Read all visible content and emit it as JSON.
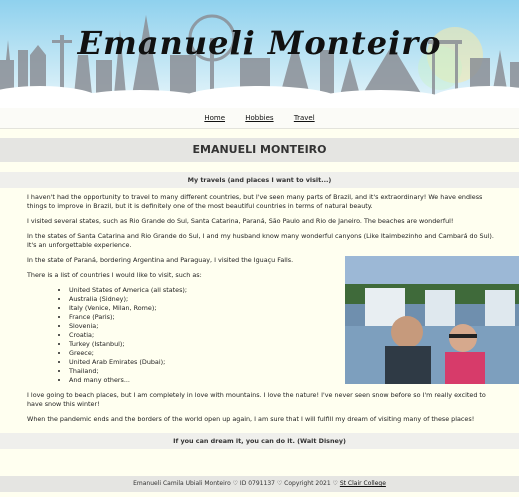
{
  "banner": {
    "title": "Emanueli Monteiro"
  },
  "nav": {
    "items": [
      "Home",
      "Hobbies",
      "Travel"
    ]
  },
  "header": {
    "title": "EMANUELI MONTEIRO"
  },
  "section": {
    "subtitle": "My travels (and places I want to visit...)"
  },
  "content": {
    "p1": "I haven't had the opportunity to travel to many different countries, but I've seen many parts of Brazil, and it's extraordinary! We have endless things to improve in Brazil, but it is definitely one of the most beautiful countries in terms of natural beauty.",
    "p2": "I visited several states, such as Rio Grande do Sul, Santa Catarina, Paraná, São Paulo and Rio de Janeiro. The beaches are wonderful!",
    "p3": "In the states of Santa Catarina and Rio Grande do Sul, I and my husband know many wonderful canyons (Like Itaimbezinho and Cambará do Sul). It's an unforgettable experience.",
    "p4": "In the state of Paraná, bordering Argentina and Paraguay, I visited the Iguaçu Falls.",
    "p5": "There is a list of countries I would like to visit, such as:",
    "countries": [
      "United States of America (all states);",
      "Australia (Sidney);",
      "Italy (Venice, Milan, Rome);",
      "France (Paris);",
      "Slovenia;",
      "Croatia;",
      "Turkey (Istanbul);",
      "Greece;",
      "United Arab Emirates (Dubai);",
      "Thailand;",
      "And many others..."
    ],
    "p6": "I love going to beach places, but I am completely in love with mountains. I love the nature! I've never seen snow before so I'm really excited to have snow this winter!",
    "p7": "When the pandemic ends and the borders of the world open up again, I am sure that I will fulfill my dream of visiting many of these places!"
  },
  "quote": "If you can dream it, you can do it. (Walt Disney)",
  "footer": {
    "text": "Emanueli Camila Ubiali Monteiro ♡ ID 0791137 ♡ Copyright 2021 ♡",
    "link": "St Clair College"
  },
  "colors": {
    "page_bg": "#fffff0",
    "band_bg": "#e5e5e2",
    "sky": "#8fd1ee"
  }
}
